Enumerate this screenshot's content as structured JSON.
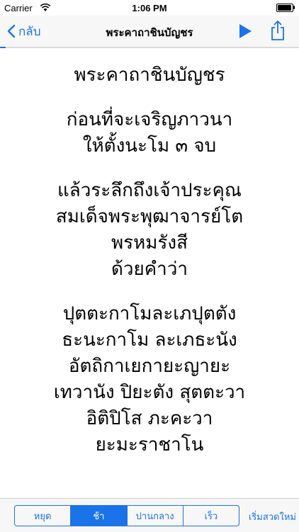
{
  "status_bar": {
    "carrier": "Carrier",
    "time": "1:06 PM",
    "wifi_icon": "wifi-icon",
    "battery_icon": "battery-icon"
  },
  "nav": {
    "back_label": "กลับ",
    "title": "พระคาถาชินบัญชร",
    "play_icon": "play-icon",
    "share_icon": "share-icon",
    "progress": 0.02
  },
  "content": {
    "paragraphs": [
      [
        "พระคาถาชินบัญชร"
      ],
      [
        "ก่อนที่จะเจริญภาวนา",
        "ให้ตั้งนะโม ๓ จบ"
      ],
      [
        "แล้วระลึกถึงเจ้าประคุณ",
        "สมเด็จพระพุฒาจารย์โต",
        "พรหมรังสี",
        "ด้วยคำว่า"
      ],
      [
        "ปุตตะกาโมละเภปุตตัง",
        "ธะนะกาโม ละเภธะนัง",
        "อัตถิกาเยกายะญายะ",
        "เทวานัง ปิยะตัง สุตตะวา",
        "อิติปิโส ภะคะวา",
        "ยะมะราชาโน"
      ]
    ]
  },
  "toolbar": {
    "speed_options": [
      "หยุด",
      "ช้า",
      "ปานกลาง",
      "เร็ว"
    ],
    "selected_speed": "ช้า",
    "restart_label": "เริ่มสวดใหม่"
  },
  "colors": {
    "accent": "#1a73e8",
    "bar_background": "#f7f7f7"
  }
}
